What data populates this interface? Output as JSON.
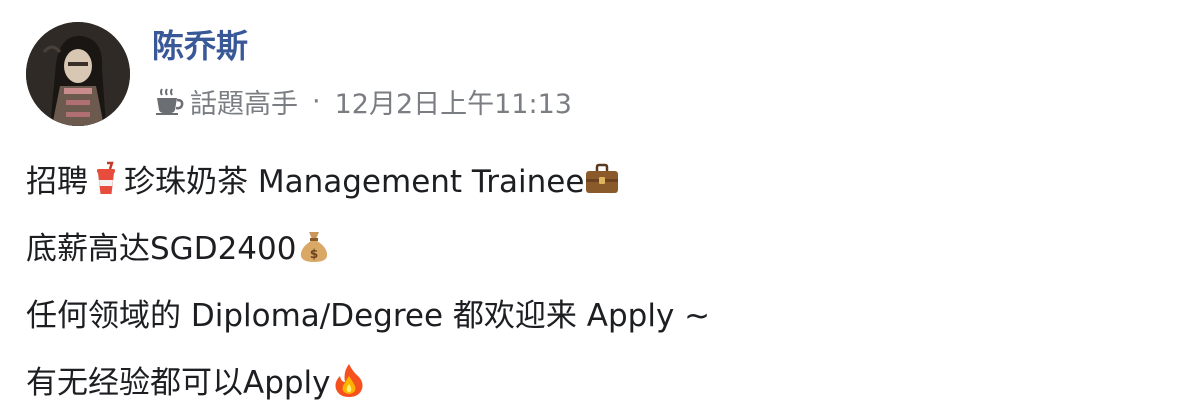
{
  "post": {
    "author": "陈乔斯",
    "badge_label": "話題高手",
    "separator": "·",
    "timestamp": "12月2日上午11:13",
    "lines": [
      {
        "before": "招聘",
        "emoji": "cup-with-straw-icon",
        "after": "珍珠奶茶 Management Trainee",
        "trailing_emoji": "briefcase-icon"
      },
      {
        "before": "底薪高达SGD2400",
        "trailing_emoji": "money-bag-icon"
      },
      {
        "before": "任何领域的 Diploma/Degree 都欢迎来 Apply ~"
      },
      {
        "before": "有无经验都可以Apply",
        "trailing_emoji": "fire-icon"
      }
    ]
  },
  "colors": {
    "author_name": "#385898",
    "meta_text": "#7a7d82",
    "body_text": "#1c1e21"
  }
}
